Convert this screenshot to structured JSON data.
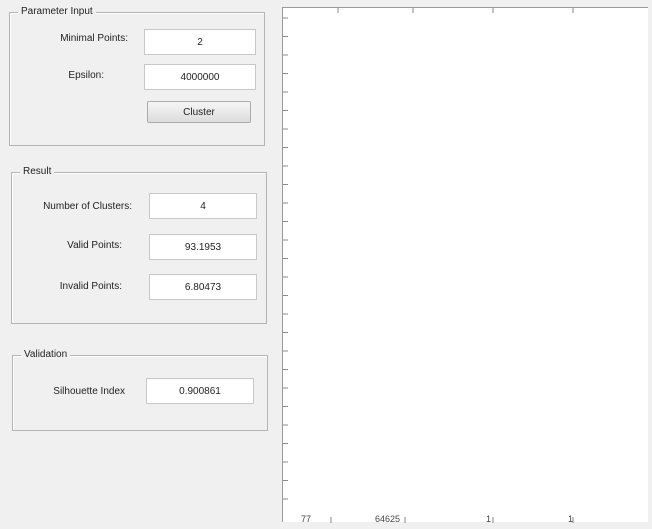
{
  "parameter_input": {
    "title": "Parameter Input",
    "min_points_label": "Minimal Points:",
    "min_points_value": "2",
    "epsilon_label": "Epsilon:",
    "epsilon_value": "4000000",
    "cluster_button": "Cluster"
  },
  "result": {
    "title": "Result",
    "clusters_label": "Number of Clusters:",
    "clusters_value": "4",
    "valid_label": "Valid Points:",
    "valid_value": "93.1953",
    "invalid_label": "Invalid Points:",
    "invalid_value": "6.80473"
  },
  "validation": {
    "title": "Validation",
    "silhouette_label": "Silhouette Index",
    "silhouette_value": "0.900861"
  },
  "axes": {
    "x_tick_labels": [
      "77",
      "64625",
      "1",
      "1"
    ]
  }
}
